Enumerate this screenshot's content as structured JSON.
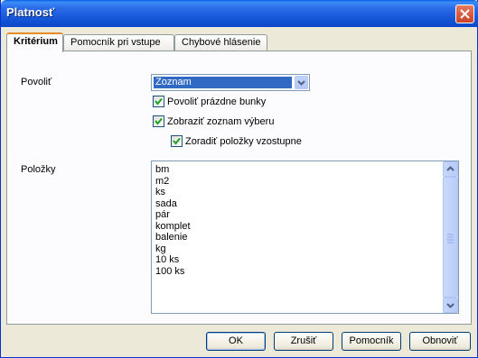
{
  "window": {
    "title": "Platnosť"
  },
  "tabs": [
    {
      "label": "Kritérium"
    },
    {
      "label": "Pomocník pri vstupe"
    },
    {
      "label": "Chybové hlásenie"
    }
  ],
  "criteria": {
    "allow_label": "Povoliť",
    "allow_value": "Zoznam",
    "allow_blank_label": "Povoliť prázdne bunky",
    "allow_blank_checked": true,
    "show_list_label": "Zobraziť zoznam výberu",
    "show_list_checked": true,
    "sort_label": "Zoradiť položky vzostupne",
    "sort_checked": true,
    "entries_label": "Položky",
    "entries": [
      "bm",
      "m2",
      "ks",
      "sada",
      "pár",
      "komplet",
      "balenie",
      "kg",
      "10 ks",
      "100 ks"
    ]
  },
  "buttons": {
    "ok": "OK",
    "cancel": "Zrušiť",
    "help": "Pomocník",
    "reset": "Obnoviť"
  }
}
